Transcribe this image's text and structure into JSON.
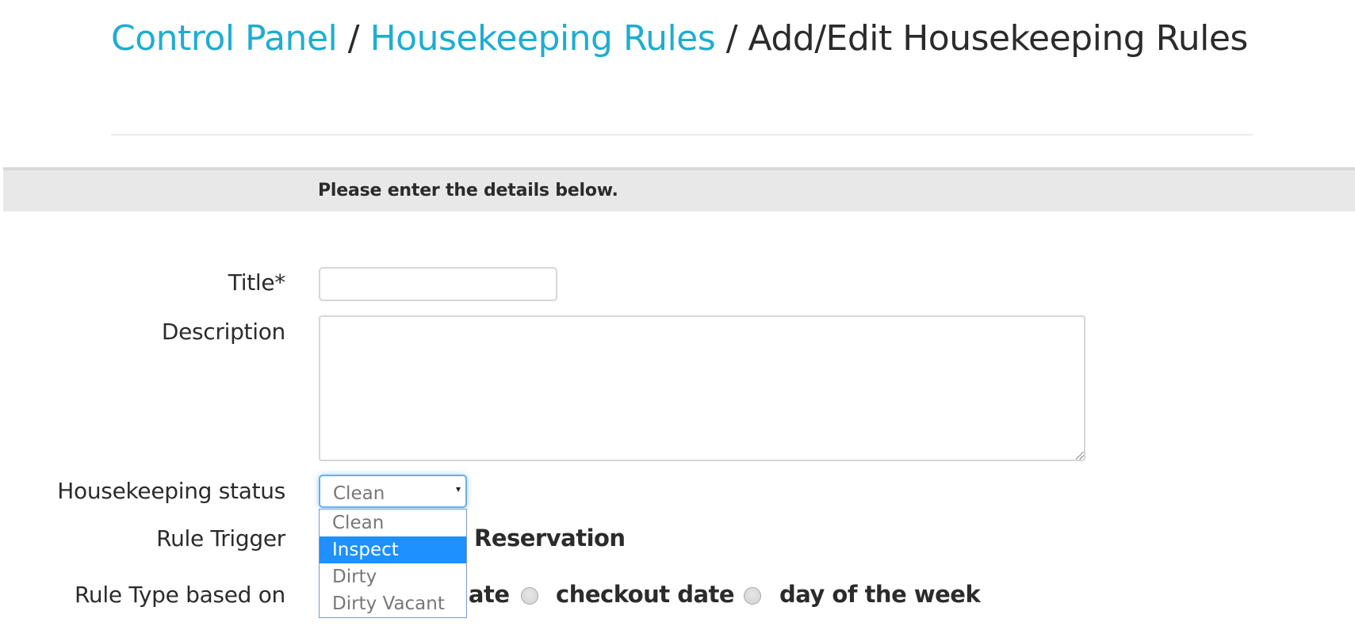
{
  "breadcrumb": {
    "items": [
      {
        "label": "Control Panel",
        "link": true
      },
      {
        "label": "Housekeeping Rules",
        "link": true
      },
      {
        "label": "Add/Edit Housekeeping Rules",
        "link": false
      }
    ],
    "separator": "/"
  },
  "colors": {
    "link": "#1eadd0",
    "highlight": "#1e90ff",
    "focus_border": "#66afe9"
  },
  "info_bar": {
    "text": "Please enter the details below."
  },
  "form": {
    "title": {
      "label": "Title*",
      "value": ""
    },
    "description": {
      "label": "Description",
      "value": ""
    },
    "housekeeping_status": {
      "label": "Housekeeping status",
      "selected": "Clean",
      "options": [
        "Clean",
        "Inspect",
        "Dirty",
        "Dirty Vacant"
      ],
      "highlighted_option": "Inspect",
      "dropdown_open": true
    },
    "rule_trigger": {
      "label": "Rule Trigger",
      "options": [
        {
          "label": "Reservation",
          "checked": false
        }
      ]
    },
    "rule_type": {
      "label": "Rule Type based on",
      "options": [
        {
          "label": "checkin date",
          "visible_fragment": "late",
          "checked": false
        },
        {
          "label": "checkout date",
          "checked": false
        },
        {
          "label": "day of the week",
          "checked": false
        }
      ]
    }
  }
}
